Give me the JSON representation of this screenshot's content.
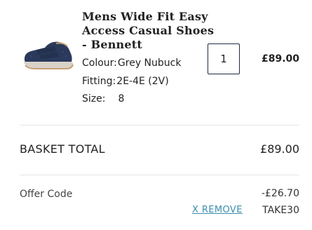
{
  "product": {
    "image_icon": "shoe-image",
    "title": "Mens Wide Fit Easy Access Casual Shoes - Bennett",
    "colour_label": "Colour:",
    "colour_value": "Grey Nubuck",
    "fitting_label": "Fitting:",
    "fitting_value": "2E-4E (2V)",
    "size_label": "Size:",
    "size_value": "8",
    "quantity": "1",
    "price": "£89.00"
  },
  "basket": {
    "total_label": "BASKET TOTAL",
    "total_value": "£89.00"
  },
  "offer": {
    "label": "Offer Code",
    "discount": "-£26.70",
    "remove_label": "X REMOVE",
    "code": "TAKE30"
  },
  "colors": {
    "link": "#3b8eb0",
    "qty_border": "#1e2a44",
    "shoe": "#2b3a5c"
  }
}
